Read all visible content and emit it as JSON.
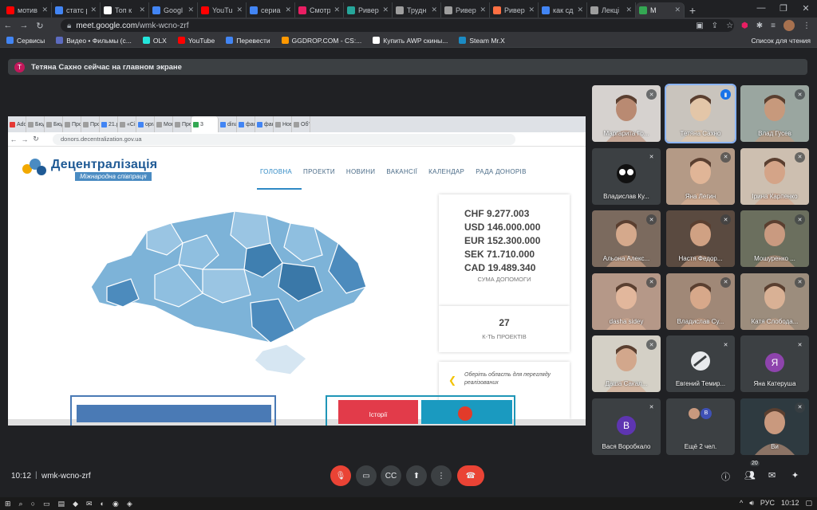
{
  "browser": {
    "tabs": [
      {
        "label": "мотив",
        "color": "#ff0000"
      },
      {
        "label": "статс р",
        "color": "#4285f4"
      },
      {
        "label": "Топ к",
        "color": "#ffffff"
      },
      {
        "label": "Googl",
        "color": "#4285f4"
      },
      {
        "label": "YouTul",
        "color": "#ff0000"
      },
      {
        "label": "сериа",
        "color": "#4285f4"
      },
      {
        "label": "Смотр",
        "color": "#e91e63"
      },
      {
        "label": "Ривер",
        "color": "#26a69a"
      },
      {
        "label": "Трудн",
        "color": "#9e9e9e"
      },
      {
        "label": "Ривер",
        "color": "#9e9e9e"
      },
      {
        "label": "Ривер",
        "color": "#ff7043"
      },
      {
        "label": "как сд",
        "color": "#4285f4"
      },
      {
        "label": "Лекці",
        "color": "#9e9e9e"
      },
      {
        "label": "M",
        "color": "#34a853"
      }
    ],
    "new_tab": "+",
    "url_host": "meet.google.com",
    "url_path": "/wmk-wcno-zrf",
    "bookmarks": [
      {
        "label": "Сервисы",
        "color": "#4285f4"
      },
      {
        "label": "Видео • Фильмы (с...",
        "color": "#5c6bc0"
      },
      {
        "label": "OLX",
        "color": "#23e5db"
      },
      {
        "label": "YouTube",
        "color": "#ff0000"
      },
      {
        "label": "Перевести",
        "color": "#4285f4"
      },
      {
        "label": "GGDROP.COM - CS:...",
        "color": "#ff9800"
      },
      {
        "label": "Купить AWP скины...",
        "color": "#ffffff"
      },
      {
        "label": "Steam Mr.X",
        "color": "#1b8bc4"
      }
    ],
    "reading_list": "Список для чтения"
  },
  "notice": {
    "initial": "Т",
    "text": "Тетяна Сахно сейчас на главном экране"
  },
  "shared": {
    "tabs": [
      "Adob",
      "Бюд",
      "Бюд",
      "Про",
      "Про",
      "21.р",
      "«Сі",
      "орга",
      "Мон",
      "Пре",
      "3",
      "dina",
      "фак",
      "фак",
      "Нов",
      "Об'є"
    ],
    "url": "donors.decentralization.gov.ua",
    "logo_title": "Децентралізація",
    "logo_sub": "Міжнародна співпраця",
    "menu": [
      "ГОЛОВНА",
      "ПРОЕКТИ",
      "НОВИНИ",
      "ВАКАНСІЇ",
      "КАЛЕНДАР",
      "РАДА ДОНОРІВ"
    ],
    "amounts": [
      "CHF 9.277.003",
      "USD 146.000.000",
      "EUR 152.300.000",
      "SEK 71.710.000",
      "CAD 19.489.340"
    ],
    "amounts_label": "СУМА ДОПОМОГИ",
    "projects_count": "27",
    "projects_label": "К-ТЬ ПРОЕКТІВ",
    "pick_text": "Оберіть область для перегляду реалізованих",
    "story_label": "Історії"
  },
  "participants": [
    {
      "name": "Маргарита Го...",
      "kind": "video",
      "bg": "#d6d2cf",
      "face": "#b98a72"
    },
    {
      "name": "Тетяна Сахно",
      "kind": "video",
      "bg": "#c9c4bd",
      "face": "#e3c6a8",
      "speaking": true
    },
    {
      "name": "Влад Гусев",
      "kind": "video",
      "bg": "#9aa6a0",
      "face": "#c7997c"
    },
    {
      "name": "Владислав Ку...",
      "kind": "icon",
      "bg": "#3c4043"
    },
    {
      "name": "Яна Легин",
      "kind": "video",
      "bg": "#b49a86",
      "face": "#e0b597"
    },
    {
      "name": "Ірина Карпенко",
      "kind": "video",
      "bg": "#cdbfb0",
      "face": "#d4a488"
    },
    {
      "name": "Альона Алекс...",
      "kind": "video",
      "bg": "#7b6a5e",
      "face": "#d5a98c"
    },
    {
      "name": "Настя Федор...",
      "kind": "video",
      "bg": "#5a4a40",
      "face": "#d0a183"
    },
    {
      "name": "Мошуренко ...",
      "kind": "video",
      "bg": "#6b6f5e",
      "face": "#c99a80"
    },
    {
      "name": "dasha sidey",
      "kind": "video",
      "bg": "#b59888",
      "face": "#e2b79c"
    },
    {
      "name": "Владислав Су...",
      "kind": "video",
      "bg": "#a08877",
      "face": "#d7a88a"
    },
    {
      "name": "Катя Слобода...",
      "kind": "video",
      "bg": "#9c8d7d",
      "face": "#d9b195"
    },
    {
      "name": "Даша Сакал...",
      "kind": "video",
      "bg": "#d4d0c6",
      "face": "#d2a78c"
    },
    {
      "name": "Евгений Темир...",
      "kind": "icon2",
      "bg": "#3c4043"
    },
    {
      "name": "Яна Катеруша",
      "kind": "letter",
      "letter": "Я",
      "color": "#8e44ad"
    },
    {
      "name": "Вася Воробкало",
      "kind": "letter",
      "letter": "В",
      "color": "#5e35b1"
    },
    {
      "name": "Ещё 2 чел.",
      "kind": "more",
      "letter": "В",
      "color": "#3f51b5"
    },
    {
      "name": "Ви",
      "kind": "video",
      "bg": "#2e3a40",
      "face": "#c9997e"
    }
  ],
  "meeting": {
    "time": "10:12",
    "code": "wmk-wcno-zrf",
    "people_count": "20"
  },
  "taskbar": {
    "lang": "РУС",
    "time": "10:12"
  }
}
